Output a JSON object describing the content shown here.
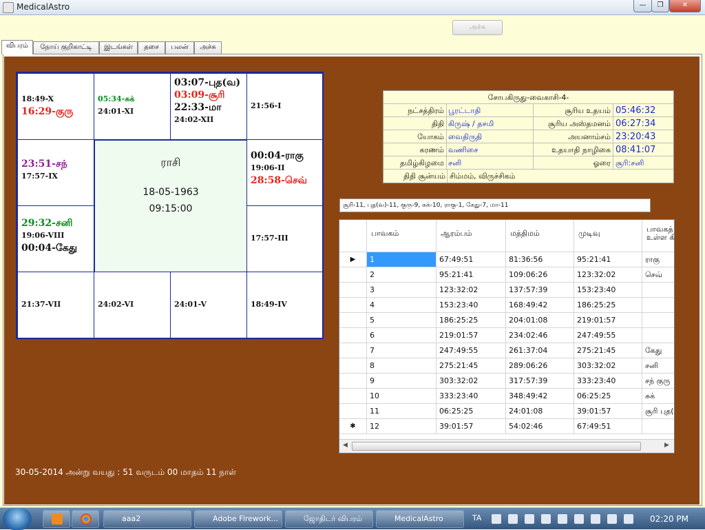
{
  "window": {
    "title": "MedicalAstro",
    "min": "—",
    "max": "❐",
    "close": "✕"
  },
  "toolbar": {
    "print_label": "அச்சு"
  },
  "tabs": [
    "விபரம்",
    "நோய் குறிகாட்டி",
    "இடங்கள்",
    "தசை",
    "பலன்",
    "அச்சு"
  ],
  "chart": {
    "rasi_label": "ராசி",
    "date": "18-05-1963",
    "time": "09:15:00",
    "cells": {
      "r1c1": [
        {
          "text": "18:49-X",
          "color": "black"
        },
        {
          "text": "16:29-குரு",
          "color": "red",
          "big": true
        }
      ],
      "r1c2": [
        {
          "text": "05:34-சுக்",
          "color": "green"
        },
        {
          "text": "24:01-XI",
          "color": "black"
        }
      ],
      "r1c3": [
        {
          "text": "03:07-புத(வ)",
          "color": "black",
          "big": true
        },
        {
          "text": "03:09-சூரி",
          "color": "red",
          "big": true
        },
        {
          "text": "22:33-மா",
          "color": "black",
          "big": true
        },
        {
          "text": "24:02-XII",
          "color": "black"
        }
      ],
      "r1c4": [
        {
          "text": "21:56-I",
          "color": "black"
        }
      ],
      "r2c1": [
        {
          "text": "23:51-சந்",
          "color": "purple",
          "big": true
        },
        {
          "text": "17:57-IX",
          "color": "black"
        }
      ],
      "r2c4": [
        {
          "text": "00:04-ராகு",
          "color": "black",
          "big": true
        },
        {
          "text": "19:06-II",
          "color": "black"
        },
        {
          "text": "28:58-செவ்",
          "color": "red",
          "big": true
        }
      ],
      "r3c1": [
        {
          "text": "29:32-சனி",
          "color": "green",
          "big": true
        },
        {
          "text": "19:06-VIII",
          "color": "black"
        },
        {
          "text": "00:04-கேது",
          "color": "black",
          "big": true
        }
      ],
      "r3c4": [
        {
          "text": "17:57-III",
          "color": "black"
        }
      ],
      "r4c1": [
        {
          "text": "21:37-VII",
          "color": "black"
        }
      ],
      "r4c2": [
        {
          "text": "24:02-VI",
          "color": "black"
        }
      ],
      "r4c3": [
        {
          "text": "24:01-V",
          "color": "black"
        }
      ],
      "r4c4": [
        {
          "text": "18:49-IV",
          "color": "black"
        }
      ]
    }
  },
  "panchangam": {
    "header": "சோபகிருது-வைகாசி-4-",
    "rows": [
      {
        "l1": "நட்சத்திரம்",
        "v1": "பூரட்டாதி",
        "l2": "சூரிய உதயம்",
        "v2": "05:46:32"
      },
      {
        "l1": "திதி",
        "v1": "கிருஷ் / தசமி",
        "l2": "சூரிய அஸ்தமனம்",
        "v2": "06:27:34"
      },
      {
        "l1": "யோகம்",
        "v1": "வைதிருதி",
        "l2": "அயனாம்சம்",
        "v2": "23:20:43"
      },
      {
        "l1": "கரணம்",
        "v1": "வணிசை",
        "l2": "உதயாதி நாழிகை",
        "v2": "08:41:07"
      },
      {
        "l1": "தமிழ்கிழமை",
        "v1": "சனி",
        "l2": "ஓரை",
        "v2": "சூரி:சனி"
      }
    ],
    "last_label": "திதி சூன்யம்",
    "last_value": "சிம்மம், விருச்சிகம்"
  },
  "aspect_text": "சூரி-11, புத(வ)-11, குரு-9, சுக்-10, ராகு-1, கேது-7, மா-11",
  "bhava_table": {
    "headers": [
      "பாவகம்",
      "ஆரம்பம்",
      "மத்திமம்",
      "முடிவு",
      "பாவகத் உள்ள கி"
    ],
    "rows": [
      [
        "1",
        "67:49:51",
        "81:36:56",
        "95:21:41",
        "ராகு"
      ],
      [
        "2",
        "95:21:41",
        "109:06:26",
        "123:32:02",
        "செவ்"
      ],
      [
        "3",
        "123:32:02",
        "137:57:39",
        "153:23:40",
        ""
      ],
      [
        "4",
        "153:23:40",
        "168:49:42",
        "186:25:25",
        ""
      ],
      [
        "5",
        "186:25:25",
        "204:01:08",
        "219:01:57",
        ""
      ],
      [
        "6",
        "219:01:57",
        "234:02:46",
        "247:49:55",
        ""
      ],
      [
        "7",
        "247:49:55",
        "261:37:04",
        "275:21:45",
        "கேது"
      ],
      [
        "8",
        "275:21:45",
        "289:06:26",
        "303:32:02",
        "சனி"
      ],
      [
        "9",
        "303:32:02",
        "317:57:39",
        "333:23:40",
        "சந் குரு"
      ],
      [
        "10",
        "333:23:40",
        "348:49:42",
        "06:25:25",
        "சுக்"
      ],
      [
        "11",
        "06:25:25",
        "24:01:08",
        "39:01:57",
        "சூரி புத(வ"
      ],
      [
        "12",
        "39:01:57",
        "54:02:46",
        "67:49:51",
        ""
      ]
    ],
    "current_row_marker": "▶",
    "new_row_marker": "✱"
  },
  "age_text": "30-05-2014  அன்று வயது  :  51  வருடம்  00  மாதம்  11  நாள்",
  "taskbar": {
    "items": [
      "aaa2",
      "Adobe Firework...",
      "ஜோதிடர் விபரம்",
      "MedicalAstro"
    ],
    "lang": "TA",
    "clock": "02:20 PM"
  }
}
